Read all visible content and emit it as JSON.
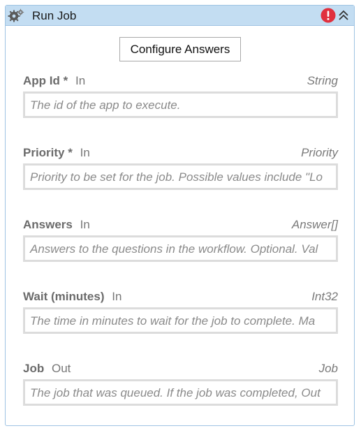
{
  "activity": {
    "title": "Run Job",
    "configure_label": "Configure Answers",
    "error_icon": "error-icon",
    "collapse_icon": "chevron-double-up-icon",
    "gear_icon": "gear-icon"
  },
  "fields": [
    {
      "name": "App Id",
      "required": "*",
      "direction": "In",
      "type": "String",
      "placeholder": "The id of the app to execute."
    },
    {
      "name": "Priority",
      "required": "*",
      "direction": "In",
      "type": "Priority",
      "placeholder": "Priority to be set for the job. Possible values include \"Lo"
    },
    {
      "name": "Answers",
      "required": "",
      "direction": "In",
      "type": "Answer[]",
      "placeholder": "Answers to the questions in the workflow. Optional. Val"
    },
    {
      "name": "Wait (minutes)",
      "required": "",
      "direction": "In",
      "type": "Int32",
      "placeholder": "The time in minutes to wait for the job to complete. Ma"
    },
    {
      "name": "Job",
      "required": "",
      "direction": "Out",
      "type": "Job",
      "placeholder": "The job that was queued. If the job was completed, Out"
    }
  ],
  "colors": {
    "titlebar": "#c3ddf2",
    "border": "#9ec3e3",
    "error": "#e0303e"
  }
}
